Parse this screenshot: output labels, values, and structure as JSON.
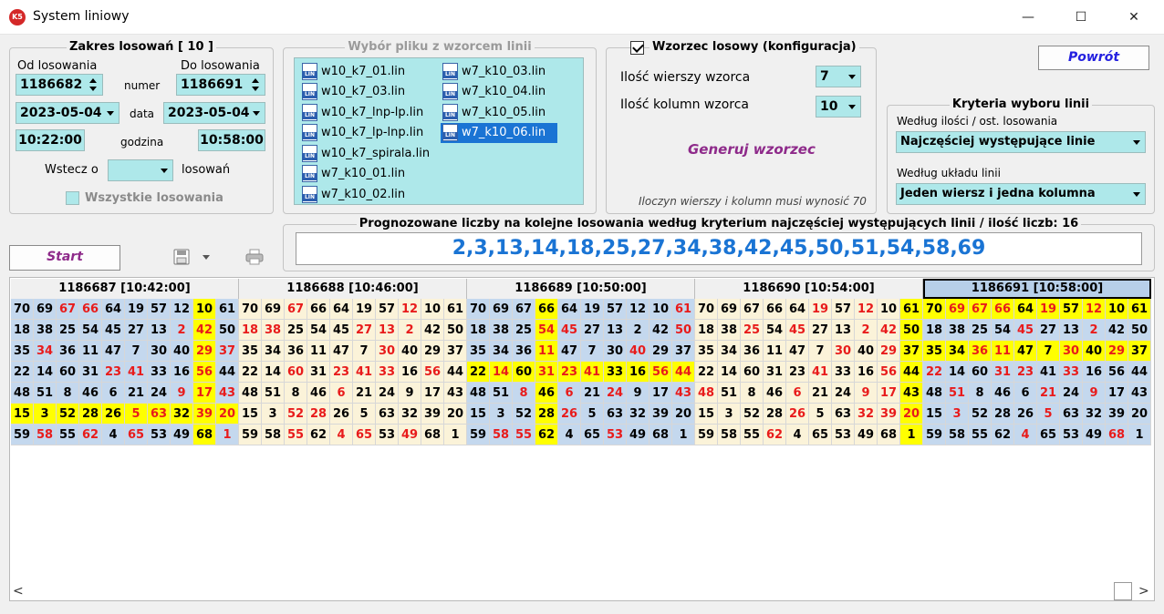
{
  "window": {
    "icon_text": "K5",
    "title": "System liniowy",
    "minimize": "—",
    "maximize": "☐",
    "close": "✕"
  },
  "range_panel": {
    "title": "Zakres losowań  [ 10 ]",
    "from_label": "Od losowania",
    "to_label": "Do losowania",
    "from_value": "1186682",
    "to_value": "1186691",
    "number_label": "numer",
    "date_from": "2023-05-04",
    "date_to": "2023-05-04",
    "date_label": "data",
    "time_from": "10:22:00",
    "time_to": "10:58:00",
    "time_label": "godzina",
    "back_label": "Wstecz o",
    "back_value": "",
    "draws_label": "losowań",
    "all_draws_label": "Wszystkie losowania"
  },
  "file_panel": {
    "title": "Wybór pliku z wzorcem linii",
    "files_col1": [
      "w10_k7_01.lin",
      "w10_k7_03.lin",
      "w10_k7_lnp-lp.lin",
      "w10_k7_lp-lnp.lin",
      "w10_k7_spirala.lin",
      "w7_k10_01.lin",
      "w7_k10_02.lin"
    ],
    "files_col2": [
      "w7_k10_03.lin",
      "w7_k10_04.lin",
      "w7_k10_05.lin",
      "w7_k10_06.lin"
    ],
    "selected": "w7_k10_06.lin"
  },
  "pattern_panel": {
    "title": "Wzorzec losowy (konfiguracja)",
    "rows_label": "Ilość wierszy wzorca",
    "rows_value": "7",
    "cols_label": "Ilość kolumn wzorca",
    "cols_value": "10",
    "generate_label": "Generuj wzorzec",
    "note": "Iloczyn wierszy i kolumn musi wynosić 70"
  },
  "back_button": "Powrót",
  "criteria_panel": {
    "title": "Kryteria wyboru linii",
    "by_count_label": "Według ilości / ost. losowania",
    "by_count_value": "Najczęściej występujące linie",
    "by_layout_label": "Według układu linii",
    "by_layout_value": "Jeden wiersz i jedna kolumna"
  },
  "prediction": {
    "title": "Prognozowane liczby na kolejne losowania według kryterium najczęściej występujących linii / ilość liczb: 16",
    "numbers": "2,3,13,14,18,25,27,34,38,42,45,50,51,54,58,69"
  },
  "start_button": "Start",
  "toolbar": {
    "save_icon": "floppy-disk-icon",
    "print_icon": "printer-icon"
  },
  "colors": {
    "field_bg": "#aee8ea",
    "highlight": "#ffff00",
    "hot_number": "#e81b1b",
    "row_blue": "#c4d8ee",
    "row_cream": "#fbf3d9",
    "accent": "#1a74d4"
  },
  "blocks": [
    {
      "header": "1186687 [10:42:00]",
      "rows": [
        [
          70,
          69,
          67,
          66,
          64,
          19,
          57,
          12,
          10,
          61
        ],
        [
          18,
          38,
          25,
          54,
          45,
          27,
          13,
          2,
          42,
          50
        ],
        [
          35,
          34,
          36,
          11,
          47,
          7,
          30,
          40,
          29,
          37
        ],
        [
          22,
          14,
          60,
          31,
          23,
          41,
          33,
          16,
          56,
          44
        ],
        [
          48,
          51,
          8,
          46,
          6,
          21,
          24,
          9,
          17,
          43
        ],
        [
          15,
          3,
          52,
          28,
          26,
          5,
          63,
          32,
          39,
          20
        ],
        [
          59,
          58,
          55,
          62,
          4,
          65,
          53,
          49,
          68,
          1
        ]
      ],
      "hot": [
        67,
        66,
        2,
        42,
        34,
        29,
        37,
        23,
        41,
        56,
        9,
        17,
        43,
        5,
        63,
        39,
        20,
        58,
        62,
        65,
        1
      ],
      "yellow_rows": [
        5
      ],
      "yellow_col": 8,
      "row_bg": "blue"
    },
    {
      "header": "1186688 [10:46:00]",
      "rows": [
        [
          70,
          69,
          67,
          66,
          64,
          19,
          57,
          12,
          10,
          61
        ],
        [
          18,
          38,
          25,
          54,
          45,
          27,
          13,
          2,
          42,
          50
        ],
        [
          35,
          34,
          36,
          11,
          47,
          7,
          30,
          40,
          29,
          37
        ],
        [
          22,
          14,
          60,
          31,
          23,
          41,
          33,
          16,
          56,
          44
        ],
        [
          48,
          51,
          8,
          46,
          6,
          21,
          24,
          9,
          17,
          43
        ],
        [
          15,
          3,
          52,
          28,
          26,
          5,
          63,
          32,
          39,
          20
        ],
        [
          59,
          58,
          55,
          62,
          4,
          65,
          53,
          49,
          68,
          1
        ]
      ],
      "hot": [
        67,
        12,
        18,
        38,
        27,
        13,
        2,
        30,
        60,
        23,
        41,
        33,
        56,
        6,
        52,
        28,
        55,
        4,
        65,
        49
      ],
      "yellow_rows": [],
      "yellow_col": -1,
      "row_bg": "cream"
    },
    {
      "header": "1186689 [10:50:00]",
      "rows": [
        [
          70,
          69,
          67,
          66,
          64,
          19,
          57,
          12,
          10,
          61
        ],
        [
          18,
          38,
          25,
          54,
          45,
          27,
          13,
          2,
          42,
          50
        ],
        [
          35,
          34,
          36,
          11,
          47,
          7,
          30,
          40,
          29,
          37
        ],
        [
          22,
          14,
          60,
          31,
          23,
          41,
          33,
          16,
          56,
          44
        ],
        [
          48,
          51,
          8,
          46,
          6,
          21,
          24,
          9,
          17,
          43
        ],
        [
          15,
          3,
          52,
          28,
          26,
          5,
          63,
          32,
          39,
          20
        ],
        [
          59,
          58,
          55,
          62,
          4,
          65,
          53,
          49,
          68,
          1
        ]
      ],
      "hot": [
        61,
        54,
        45,
        50,
        11,
        40,
        14,
        31,
        23,
        41,
        56,
        44,
        8,
        6,
        24,
        43,
        26,
        58,
        55,
        53
      ],
      "yellow_rows": [
        3
      ],
      "yellow_col": 3,
      "row_bg": "blue"
    },
    {
      "header": "1186690 [10:54:00]",
      "rows": [
        [
          70,
          69,
          67,
          66,
          64,
          19,
          57,
          12,
          10,
          61
        ],
        [
          18,
          38,
          25,
          54,
          45,
          27,
          13,
          2,
          42,
          50
        ],
        [
          35,
          34,
          36,
          11,
          47,
          7,
          30,
          40,
          29,
          37
        ],
        [
          22,
          14,
          60,
          31,
          23,
          41,
          33,
          16,
          56,
          44
        ],
        [
          48,
          51,
          8,
          46,
          6,
          21,
          24,
          9,
          17,
          43
        ],
        [
          15,
          3,
          52,
          28,
          26,
          5,
          63,
          32,
          39,
          20
        ],
        [
          59,
          58,
          55,
          62,
          4,
          65,
          53,
          49,
          68,
          1
        ]
      ],
      "hot": [
        19,
        12,
        25,
        45,
        2,
        42,
        30,
        29,
        41,
        56,
        48,
        6,
        9,
        17,
        26,
        32,
        39,
        20,
        62
      ],
      "yellow_rows": [],
      "yellow_col": 9,
      "row_bg": "cream"
    },
    {
      "header": "1186691 [10:58:00]",
      "rows": [
        [
          70,
          69,
          67,
          66,
          64,
          19,
          57,
          12,
          10,
          61
        ],
        [
          18,
          38,
          25,
          54,
          45,
          27,
          13,
          2,
          42,
          50
        ],
        [
          35,
          34,
          36,
          11,
          47,
          7,
          30,
          40,
          29,
          37
        ],
        [
          22,
          14,
          60,
          31,
          23,
          41,
          33,
          16,
          56,
          44
        ],
        [
          48,
          51,
          8,
          46,
          6,
          21,
          24,
          9,
          17,
          43
        ],
        [
          15,
          3,
          52,
          28,
          26,
          5,
          63,
          32,
          39,
          20
        ],
        [
          59,
          58,
          55,
          62,
          4,
          65,
          53,
          49,
          68,
          1
        ]
      ],
      "hot": [
        69,
        67,
        66,
        19,
        12,
        45,
        2,
        36,
        11,
        30,
        29,
        22,
        31,
        23,
        33,
        51,
        21,
        9,
        3,
        5,
        4,
        68
      ],
      "yellow_rows": [
        0,
        2
      ],
      "yellow_col": -1,
      "row_bg": "blue",
      "active": true
    }
  ]
}
